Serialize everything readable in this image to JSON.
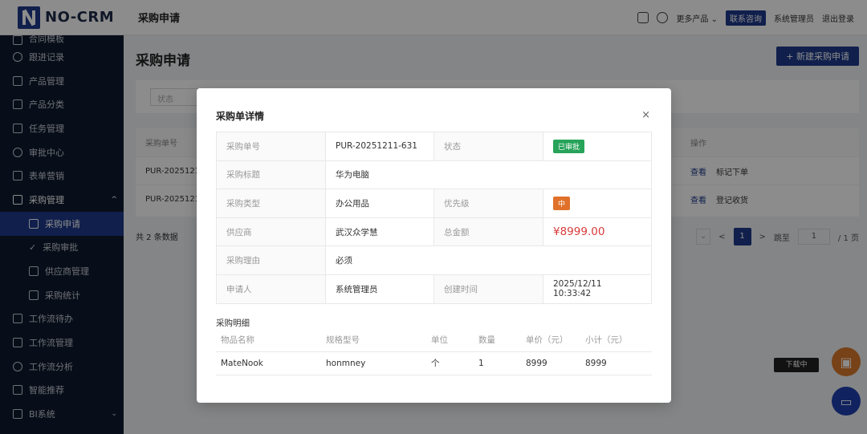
{
  "app": {
    "logo_text": "NO-CRM",
    "page_title": "采购申请"
  },
  "header_right": {
    "more_products": "更多产品",
    "contact": "联系咨询",
    "user": "系统管理员",
    "logout": "退出登录"
  },
  "sidebar": {
    "items": [
      {
        "label": "合同模板"
      },
      {
        "label": "跟进记录"
      },
      {
        "label": "产品管理"
      },
      {
        "label": "产品分类"
      },
      {
        "label": "任务管理"
      },
      {
        "label": "审批中心"
      },
      {
        "label": "表单营销"
      },
      {
        "label": "采购管理"
      },
      {
        "label": "采购申请"
      },
      {
        "label": "采购审批"
      },
      {
        "label": "供应商管理"
      },
      {
        "label": "采购统计"
      },
      {
        "label": "工作流待办"
      },
      {
        "label": "工作流管理"
      },
      {
        "label": "工作流分析"
      },
      {
        "label": "智能推荐"
      },
      {
        "label": "BI系统"
      }
    ]
  },
  "main": {
    "title": "采购申请",
    "new_button": "+ 新建采购申请",
    "filter_status_placeholder": "状态",
    "table": {
      "col_no": "采购单号",
      "col_ops": "操作",
      "rows": [
        {
          "no": "PUR-2025121",
          "view": "查看",
          "action": "标记下单"
        },
        {
          "no": "PUR-2025121",
          "view": "查看",
          "action": "登记收货"
        }
      ]
    },
    "total": "共 2 条数据",
    "pager": {
      "prev": "<",
      "current": "1",
      "next": ">",
      "goto": "跳至",
      "goto_value": "1",
      "of": "/ 1 页"
    }
  },
  "float": {
    "tag": "下载中"
  },
  "modal": {
    "title": "采购单详情",
    "close": "×",
    "fields": {
      "no_label": "采购单号",
      "no_value": "PUR-20251211-631",
      "status_label": "状态",
      "status_value": "已审批",
      "title_label": "采购标题",
      "title_value": "华为电脑",
      "type_label": "采购类型",
      "type_value": "办公用品",
      "priority_label": "优先级",
      "priority_value": "中",
      "supplier_label": "供应商",
      "supplier_value": "武汉众学慧",
      "amount_label": "总金额",
      "amount_value": "¥8999.00",
      "reason_label": "采购理由",
      "reason_value": "必须",
      "applicant_label": "申请人",
      "applicant_value": "系统管理员",
      "created_label": "创建时间",
      "created_value": "2025/12/11 10:33:42"
    },
    "detail_title": "采购明细",
    "detail_headers": [
      "物品名称",
      "规格型号",
      "单位",
      "数量",
      "单价（元）",
      "小计（元）"
    ],
    "detail_rows": [
      [
        "MateNook",
        "honmney",
        "个",
        "1",
        "8999",
        "8999"
      ]
    ]
  },
  "colors": {
    "primary": "#1e3a8a",
    "sidebar_bg": "#0f1a2e",
    "status_green": "#27a35a",
    "priority_orange": "#e0712a",
    "money_red": "#d93a3a"
  }
}
